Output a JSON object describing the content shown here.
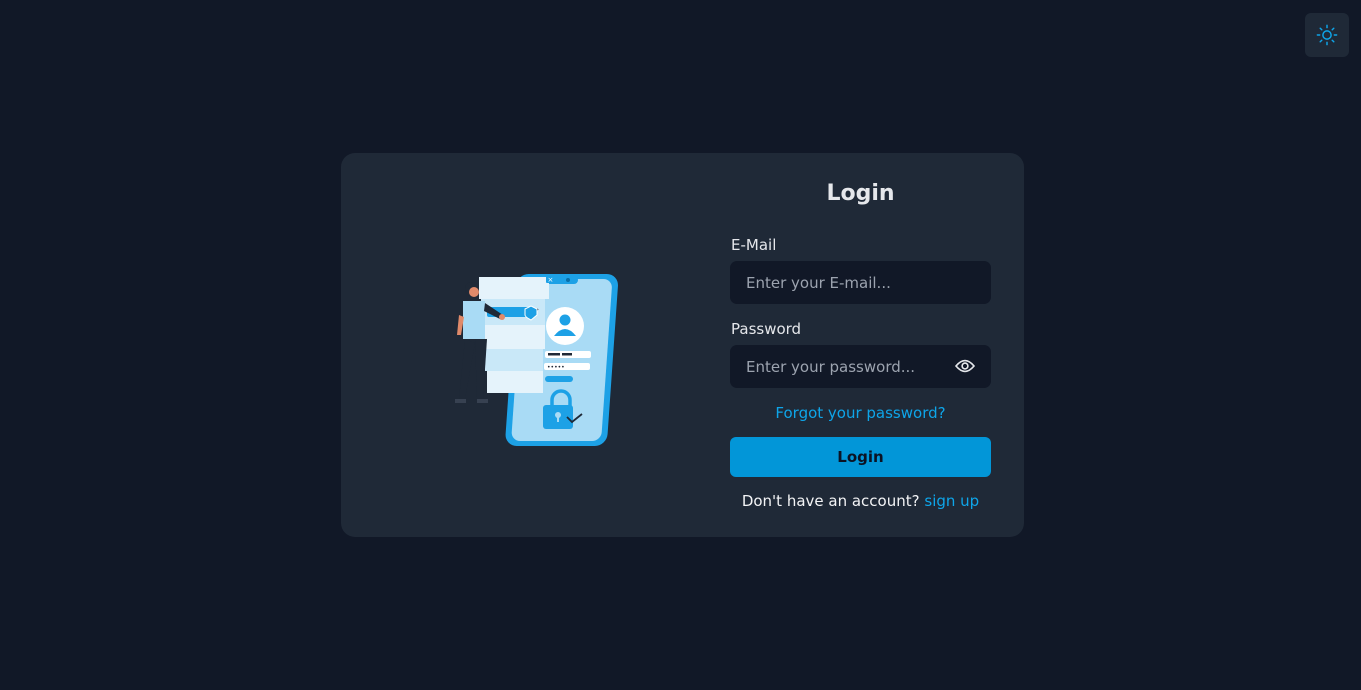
{
  "theme_toggle": {
    "icon": "sun-icon"
  },
  "login_form": {
    "title": "Login",
    "email_label": "E-Mail",
    "email_placeholder": "Enter your E-mail...",
    "email_value": "",
    "password_label": "Password",
    "password_placeholder": "Enter your password...",
    "password_value": "",
    "password_toggle_icon": "eye-icon",
    "forgot_password": "Forgot your password?",
    "submit_label": "Login",
    "signup_prompt": "Don't have an account?",
    "signup_link": "sign up"
  },
  "colors": {
    "background": "#111827",
    "card": "#1f2937",
    "accent": "#0ea5e9",
    "button": "#0296d8"
  }
}
